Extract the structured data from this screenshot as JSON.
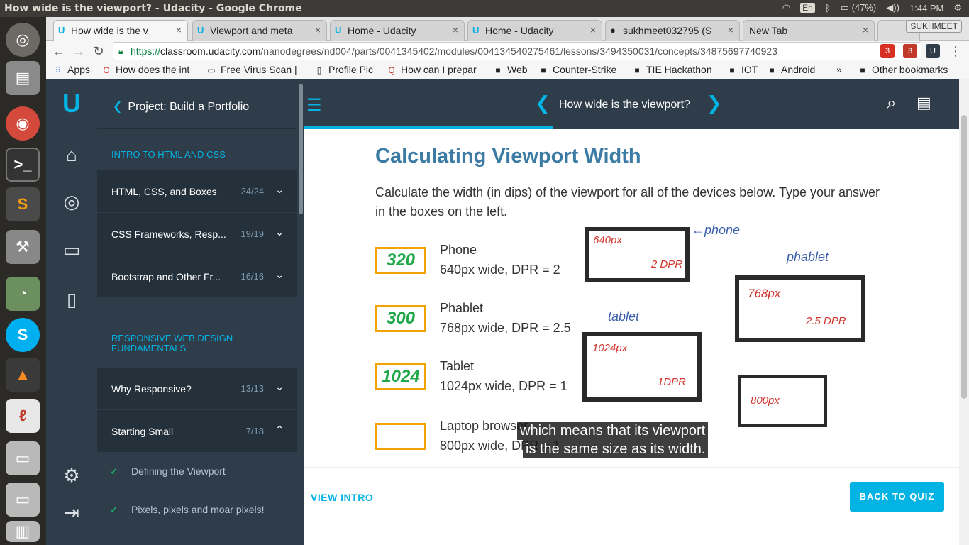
{
  "window": {
    "title": "How wide is the viewport? - Udacity - Google Chrome"
  },
  "system": {
    "lang": "En",
    "battery": "(47%)",
    "time": "1:44 PM"
  },
  "tabs": [
    {
      "label": "How wide is the v",
      "icon": "udacity-icon"
    },
    {
      "label": "Viewport and meta",
      "icon": "udacity-icon"
    },
    {
      "label": "Home - Udacity",
      "icon": "udacity-icon"
    },
    {
      "label": "Home - Udacity",
      "icon": "udacity-icon"
    },
    {
      "label": "sukhmeet032795 (S",
      "icon": "github-icon"
    },
    {
      "label": "New Tab",
      "icon": ""
    }
  ],
  "profile": {
    "name": "SUKHMEET"
  },
  "omnibox": {
    "scheme": "https://",
    "host": "classroom.udacity.com",
    "path": "/nanodegrees/nd004/parts/0041345402/modules/004134540275461/lessons/3494350031/concepts/34875697740923"
  },
  "extensions": [
    {
      "badge": "3"
    },
    {
      "badge": "3"
    }
  ],
  "bookmarks": [
    {
      "label": "Apps"
    },
    {
      "label": "How does the int"
    },
    {
      "label": "Free Virus Scan |"
    },
    {
      "label": "Profile Pic"
    },
    {
      "label": "How can I prepar"
    },
    {
      "label": "Web"
    },
    {
      "label": "Counter-Strike"
    },
    {
      "label": "TIE Hackathon"
    },
    {
      "label": "IOT"
    },
    {
      "label": "Android"
    },
    {
      "label": "»"
    },
    {
      "label": "Other bookmarks"
    }
  ],
  "sidebar": {
    "back_label": "Project: Build a Portfolio",
    "section1": "INTRO TO HTML AND CSS",
    "lessons1": [
      {
        "title": "HTML, CSS, and Boxes",
        "count": "24/24"
      },
      {
        "title": "CSS Frameworks, Resp...",
        "count": "19/19"
      },
      {
        "title": "Bootstrap and Other Fr...",
        "count": "16/16"
      }
    ],
    "section2": "RESPONSIVE WEB DESIGN FUNDAMENTALS",
    "lessons2": [
      {
        "title": "Why Responsive?",
        "count": "13/13"
      },
      {
        "title": "Starting Small",
        "count": "7/18"
      }
    ],
    "concepts": [
      {
        "title": "Defining the Viewport"
      },
      {
        "title": "Pixels, pixels and moar pixels!"
      }
    ]
  },
  "header": {
    "concept_title": "How wide is the viewport?"
  },
  "progress": {
    "fraction": 0.38
  },
  "video": {
    "title": "Calculating Viewport Width",
    "description": "Calculate the width (in dips) of the viewport for all of the devices below. Type your answer in the boxes on the left.",
    "devices": [
      {
        "answer": "320",
        "name": "Phone",
        "spec": "640px wide, DPR = 2"
      },
      {
        "answer": "300",
        "name": "Phablet",
        "spec": "768px wide, DPR = 2.5"
      },
      {
        "answer": "1024",
        "name": "Tablet",
        "spec": "1024px wide, DPR = 1"
      },
      {
        "answer": "",
        "name": "Laptop browser",
        "spec": "800px wide, DPR = 1"
      }
    ],
    "sketch": {
      "phone_px": "640px",
      "phone_dpr": "2 DPR",
      "phone_label": "←phone",
      "phablet_px": "768px",
      "phablet_dpr": "2.5 DPR",
      "phablet_label": "phablet",
      "tablet_px": "1024px",
      "tablet_dpr": "1DPR",
      "tablet_label": "tablet",
      "laptop_px": "800px"
    },
    "caption_line1": "which means that its viewport",
    "caption_line2": "is the same size as its width."
  },
  "footer": {
    "view_intro": "VIEW INTRO",
    "back_to_quiz": "BACK TO QUIZ"
  }
}
